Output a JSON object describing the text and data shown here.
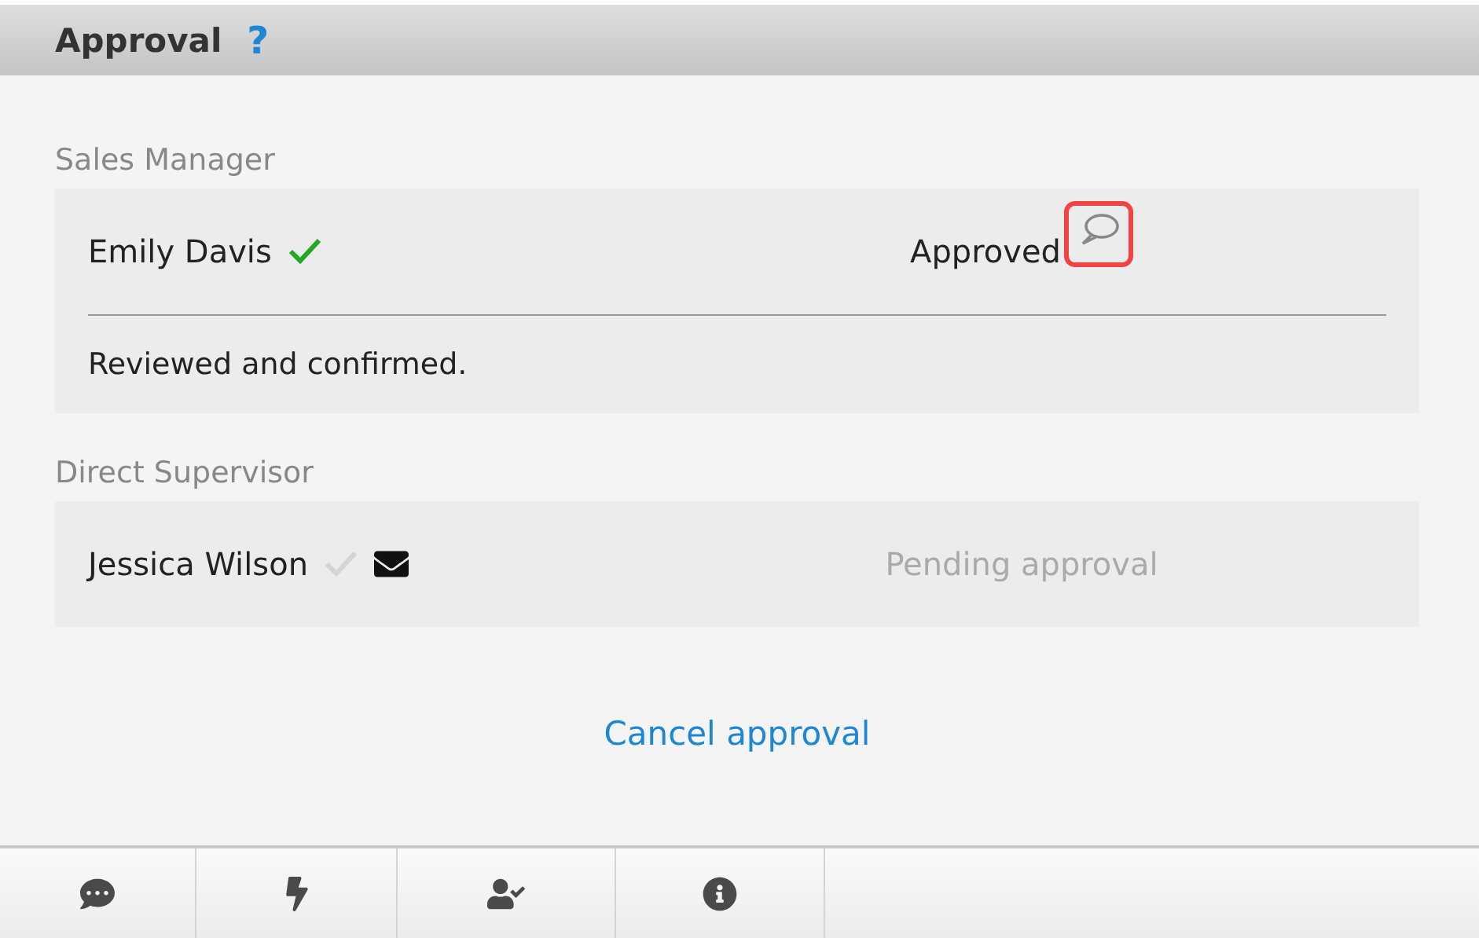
{
  "header": {
    "title": "Approval",
    "help": "?"
  },
  "steps": [
    {
      "role": "Sales Manager",
      "approver": "Emily Davis",
      "approved": true,
      "status": "Approved",
      "pending": false,
      "comment_highlighted": true,
      "comment": "Reviewed and confirmed."
    },
    {
      "role": "Direct Supervisor",
      "approver": "Jessica Wilson",
      "approved": false,
      "mail": true,
      "status": "Pending approval",
      "pending": true
    }
  ],
  "cancel_link": "Cancel approval"
}
